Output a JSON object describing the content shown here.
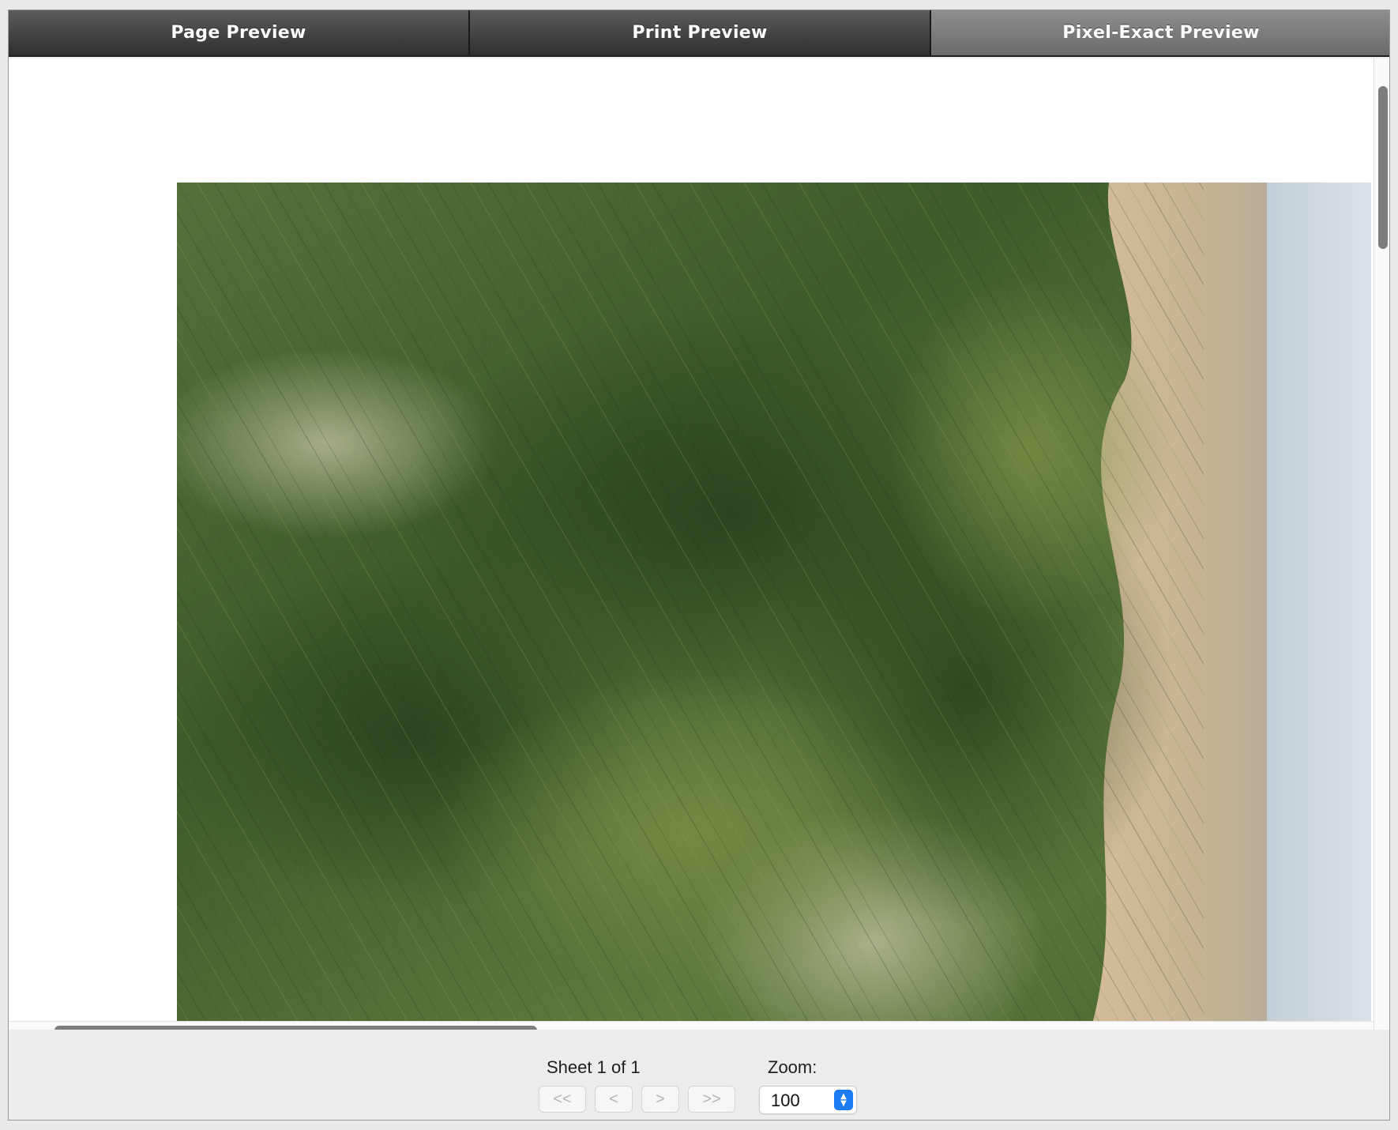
{
  "tabs": [
    {
      "label": "Page Preview",
      "selected": false
    },
    {
      "label": "Print Preview",
      "selected": false
    },
    {
      "label": "Pixel‑Exact Preview",
      "selected": true
    }
  ],
  "preview": {
    "image_description_icon": "landscape-photo"
  },
  "footer": {
    "sheet_text": "Sheet 1 of 1",
    "zoom_label": "Zoom:",
    "zoom_value": "100",
    "nav": {
      "first": "<<",
      "prev": "<",
      "next": ">",
      "last": ">>"
    }
  },
  "colors": {
    "stepper_accent": "#1a7cf5",
    "tab_selected": "#7c7c7c",
    "tab_default": "#3f3f3f"
  }
}
